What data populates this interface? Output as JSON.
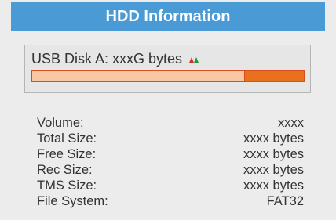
{
  "title": "HDD Information",
  "disk": {
    "label": "USB Disk A: xxxG bytes",
    "usage_fraction": 0.78
  },
  "info_rows": [
    {
      "key": "Volume:",
      "value": "xxxx"
    },
    {
      "key": "Total Size:",
      "value": "xxxx bytes"
    },
    {
      "key": "Free Size:",
      "value": "xxxx bytes"
    },
    {
      "key": "Rec Size:",
      "value": "xxxx bytes"
    },
    {
      "key": "TMS Size:",
      "value": "xxxx bytes"
    },
    {
      "key": "File System:",
      "value": "FAT32"
    }
  ],
  "colors": {
    "title_bar": "#4a9bd5",
    "bar_used": "#f8c8a6",
    "bar_free": "#e8701f",
    "marker_red": "#d83030",
    "marker_green": "#1f9a3a"
  }
}
